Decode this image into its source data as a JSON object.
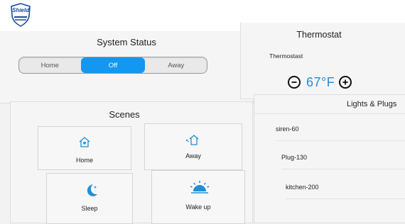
{
  "brand": {
    "logo_text": "Shield"
  },
  "system_status": {
    "title": "System Status",
    "modes": [
      "Home",
      "Off",
      "Away"
    ],
    "active_mode": "Off"
  },
  "thermostat": {
    "title": "Thermostat",
    "device_name": "Thermostast",
    "temperature": "67°F",
    "decrease_icon": "minus-circle-icon",
    "increase_icon": "plus-circle-icon"
  },
  "scenes": {
    "title": "Scenes",
    "items": [
      {
        "label": "Home",
        "icon": "house-heart-icon"
      },
      {
        "label": "Away",
        "icon": "house-away-icon"
      },
      {
        "label": "Sleep",
        "icon": "moon-stars-icon"
      },
      {
        "label": "Wake up",
        "icon": "sunrise-icon"
      }
    ]
  },
  "lights_plugs": {
    "title": "Lights & Plugs",
    "devices": [
      "siren-60",
      "Plug-130",
      "kitchen-200"
    ]
  },
  "colors": {
    "accent": "#1497f0",
    "temperature": "#2a8ad8",
    "logo": "#1a4fa0"
  }
}
